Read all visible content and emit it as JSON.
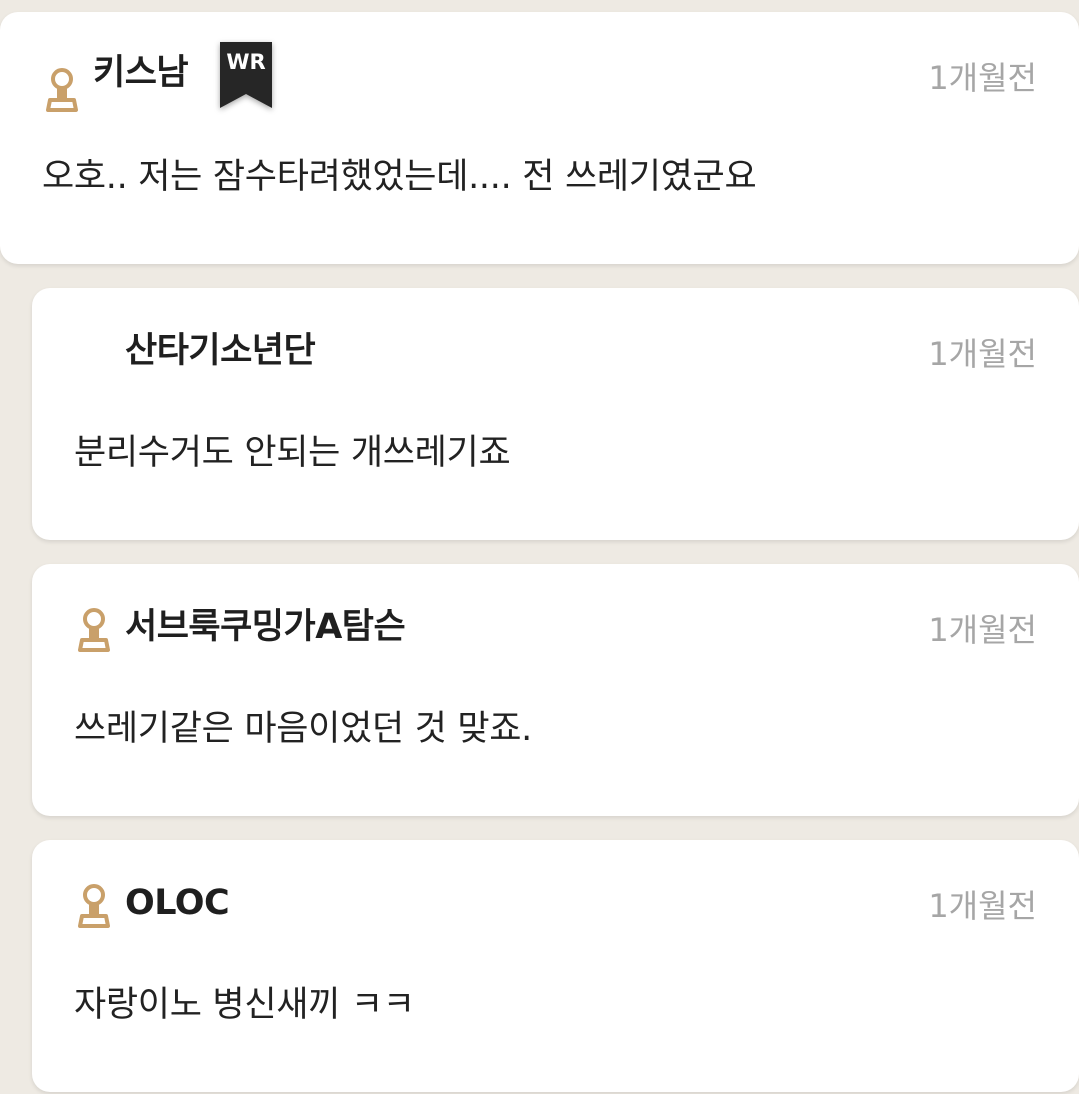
{
  "comments": [
    {
      "author": "키스남",
      "badge": "WR",
      "time": "1개월전",
      "text": "오호.. 저는 잠수타려했었는데.... 전 쓰레기였군요",
      "has_rank_icon": true
    },
    {
      "author": "산타기소년단",
      "time": "1개월전",
      "text": "분리수거도 안되는 개쓰레기죠",
      "has_rank_icon": false
    },
    {
      "author": "서브룩쿠밍가A탐슨",
      "time": "1개월전",
      "text": "쓰레기같은 마음이었던 것 맞죠.",
      "has_rank_icon": true
    },
    {
      "author": "OLOC",
      "time": "1개월전",
      "text": "자랑이노 병신새끼 ㅋㅋ",
      "has_rank_icon": true
    }
  ],
  "colors": {
    "background": "#eeeae3",
    "card": "#ffffff",
    "rank_icon": "#c9a06a",
    "badge": "#262626",
    "time": "#a6a6a6"
  }
}
